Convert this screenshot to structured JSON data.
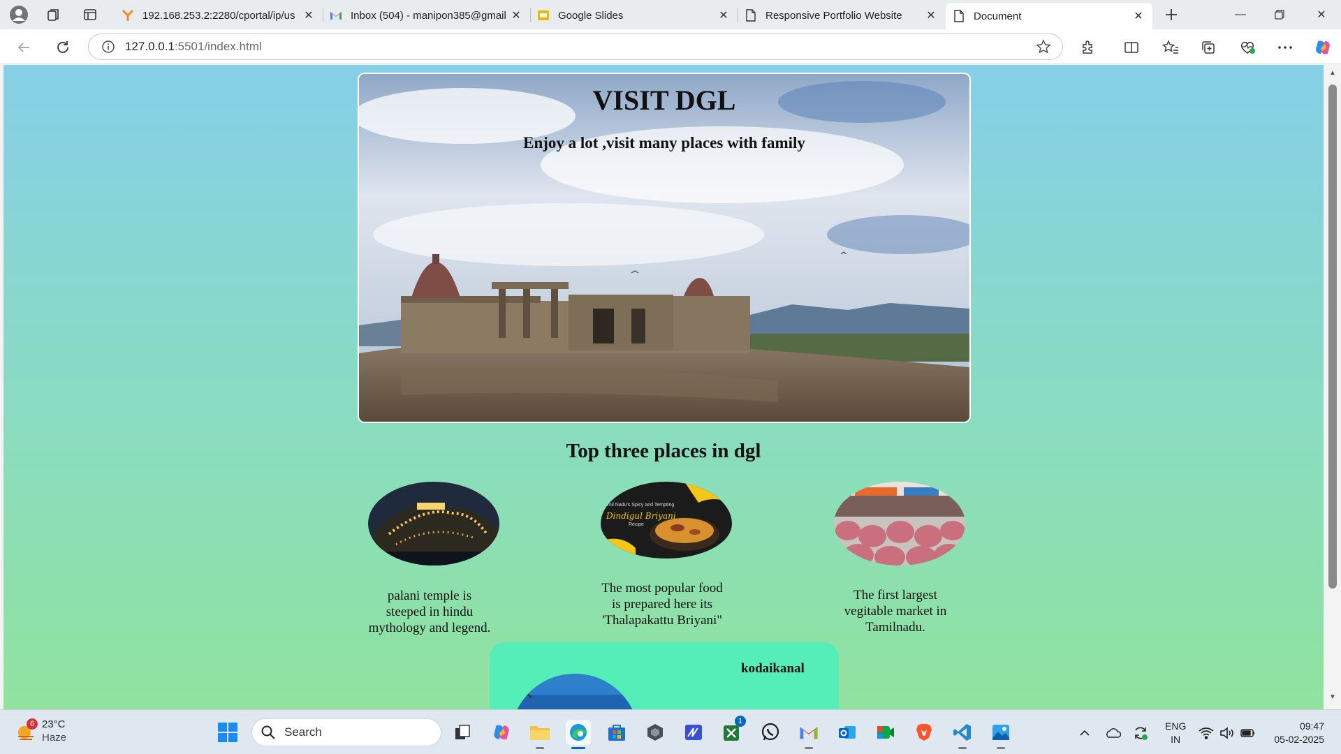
{
  "browser": {
    "tabs": [
      {
        "title": "192.168.253.2:2280/cportal/ip/us",
        "favicon": "firewall-portal-icon",
        "active": false
      },
      {
        "title": "Inbox (504) - manipon385@gmail",
        "favicon": "gmail-icon",
        "active": false
      },
      {
        "title": "Google Slides",
        "favicon": "google-slides-icon",
        "active": false
      },
      {
        "title": "Responsive Portfolio Website",
        "favicon": "document-icon",
        "active": false
      },
      {
        "title": "Document",
        "favicon": "document-icon",
        "active": true
      }
    ],
    "address": {
      "host": "127.0.0.1",
      "rest": ":5501/index.html"
    }
  },
  "page": {
    "hero_title": "VISIT DGL",
    "hero_subtitle": "Enjoy a lot ,visit many places with family",
    "section_title": "Top three places in dgl",
    "places": [
      {
        "caption_lines": [
          "palani temple is",
          "steeped in hindu",
          "mythology and legend."
        ]
      },
      {
        "caption_lines": [
          "The most popular food",
          "is prepared here its",
          "'Thalapakattu Briyani\""
        ],
        "image_text": [
          "amil Nadu's Spicy and Tempting",
          "Dindigul Briyani",
          "Recipe"
        ]
      },
      {
        "caption_lines": [
          "The first largest",
          "vegitable market in",
          "Tamilnadu."
        ]
      }
    ],
    "card_title": "kodaikanal"
  },
  "taskbar": {
    "weather": {
      "temp": "23°C",
      "condition": "Haze",
      "badge": "6"
    },
    "search_label": "Search",
    "excel_badge": "1",
    "lang": {
      "line1": "ENG",
      "line2": "IN"
    },
    "clock": {
      "time": "09:47",
      "date": "05-02-2025"
    }
  },
  "colors": {
    "page_gradient_top": "#86cfe8",
    "page_gradient_bottom": "#90e39e",
    "card_bg": "#55eeb8",
    "accent": "#0067c0"
  }
}
